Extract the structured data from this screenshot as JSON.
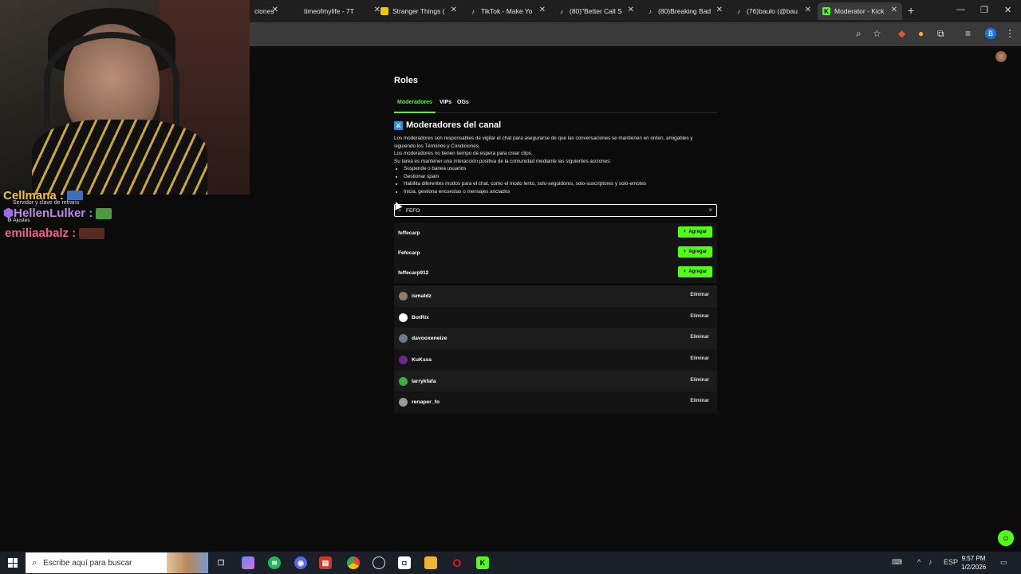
{
  "browser": {
    "tabs": [
      {
        "label": "ciones",
        "icon": ""
      },
      {
        "label": "timeofmylife - 7T",
        "icon": ""
      },
      {
        "label": "Stranger Things (",
        "icon": "stranger-things-icon"
      },
      {
        "label": "TikTok - Make Yo",
        "icon": "tiktok-icon"
      },
      {
        "label": "(80)\"Better Call S",
        "icon": "tiktok-icon"
      },
      {
        "label": "(80)Breaking Bad",
        "icon": "tiktok-icon"
      },
      {
        "label": "(76)baulo (@bau",
        "icon": "tiktok-icon"
      },
      {
        "label": "Moderator - Kick",
        "icon": "kick-icon",
        "active": true
      }
    ],
    "new_tab": "+",
    "window_controls": {
      "minimize": "—",
      "maximize": "❐",
      "close": "✕"
    },
    "profile_initial": "B"
  },
  "chat": {
    "lines": [
      {
        "user": "Cellmana :",
        "color": "#f2c33a"
      },
      {
        "user": "HellenLulker :",
        "color": "#b98ae6"
      },
      {
        "user": "emiliaabalz :",
        "color": "#f06292"
      }
    ],
    "tooltip": "Servidor y clave de retrans",
    "settings": "Ajustes"
  },
  "page": {
    "title": "Roles",
    "tabs": [
      "Moderadores",
      "VIPs",
      "OGs"
    ],
    "section_title": "Moderadores del canal",
    "desc_lines": [
      "Los moderadores son responsables de vigilar el chat para asegurarse de que las conversaciones se mantienen en orden, amigables y",
      "siguiendo los Términos y Condiciones.",
      "Los moderadores no tienen tiempo de espera para crear clips.",
      "Su tarea es mantener una interacción positiva de la comunidad mediante las siguientes acciones:"
    ],
    "bullets": [
      "Suspende o banea usuarios",
      "Gestionar spam",
      "Habilita diferentes modos para el chat, como el modo lento, solo-seguidores, solo-suscriptores y solo-emotes",
      "Inicia, gestiona encuestas o mensajes anclados"
    ],
    "search": {
      "value": "FEFO",
      "clear": "×"
    },
    "results": [
      {
        "name": "feffecarp",
        "action": "Agregar"
      },
      {
        "name": "Fefocarp",
        "action": "Agregar"
      },
      {
        "name": "feffecarp912",
        "action": "Agregar"
      }
    ],
    "moderators": [
      {
        "name": "ismaldz",
        "action": "Eliminar",
        "avatar_color": "#8a7d73"
      },
      {
        "name": "BotRix",
        "action": "Eliminar",
        "avatar_color": "#ffffff"
      },
      {
        "name": "davooxeneize",
        "action": "Eliminar",
        "avatar_color": "#6c7a8a"
      },
      {
        "name": "KuKsss",
        "action": "Eliminar",
        "avatar_color": "#6a2a8a"
      },
      {
        "name": "larrykfafa",
        "action": "Eliminar",
        "avatar_color": "#3cae3c"
      },
      {
        "name": "renaper_fo",
        "action": "Eliminar",
        "avatar_color": "#9a9a9a"
      }
    ]
  },
  "taskbar": {
    "search_placeholder": "Escribe aquí para buscar",
    "language": "ESP",
    "time": "9:57 PM",
    "date": "1/2/2026"
  },
  "colors": {
    "accent": "#53fc18",
    "background": "#0b0b0c"
  }
}
